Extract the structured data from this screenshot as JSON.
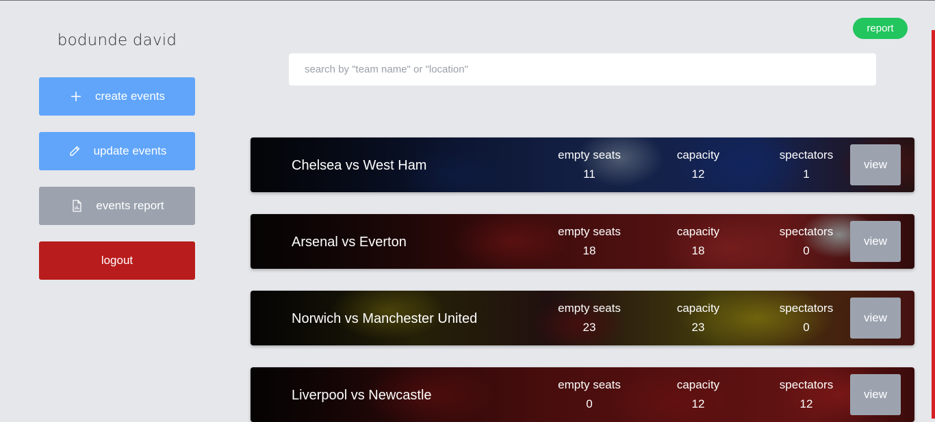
{
  "user": {
    "name": "bodunde david"
  },
  "sidebar": {
    "items": [
      {
        "label": "create events",
        "icon": "plus-icon"
      },
      {
        "label": "update events",
        "icon": "pencil-icon"
      },
      {
        "label": "events report",
        "icon": "report-file-icon"
      },
      {
        "label": "logout"
      }
    ]
  },
  "header": {
    "report_label": "report"
  },
  "search": {
    "placeholder": "search by \"team name\" or \"location\"",
    "value": ""
  },
  "events": {
    "columns": [
      "empty seats",
      "capacity",
      "spectators"
    ],
    "view_label": "view",
    "rows": [
      {
        "title": "Chelsea vs West Ham",
        "empty_seats": "11",
        "capacity": "12",
        "spectators": "1"
      },
      {
        "title": "Arsenal vs Everton",
        "empty_seats": "18",
        "capacity": "18",
        "spectators": "0"
      },
      {
        "title": "Norwich vs Manchester United",
        "empty_seats": "23",
        "capacity": "23",
        "spectators": "0"
      },
      {
        "title": "Liverpool vs Newcastle",
        "empty_seats": "0",
        "capacity": "12",
        "spectators": "12"
      }
    ]
  },
  "colors": {
    "background": "#e6e7eb",
    "primary_button": "#60a5fa",
    "muted_button": "#9ca3af",
    "logout_button": "#b91c1c",
    "report_pill": "#22c55e",
    "accent_red": "#d81f26"
  }
}
